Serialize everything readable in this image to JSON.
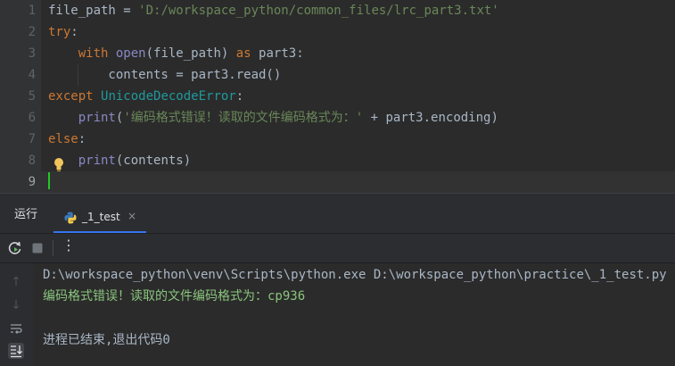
{
  "editor": {
    "line_numbers": [
      "1",
      "2",
      "3",
      "4",
      "5",
      "6",
      "7",
      "8",
      "9"
    ],
    "lines": [
      {
        "parts": [
          {
            "t": "file_path",
            "c": "var"
          },
          {
            "t": " = ",
            "c": "var"
          },
          {
            "t": "'D:/workspace_python/common_files/lrc_part3.txt'",
            "c": "str"
          }
        ]
      },
      {
        "parts": [
          {
            "t": "try",
            "c": "kw"
          },
          {
            "t": ":",
            "c": "var"
          }
        ]
      },
      {
        "parts": [
          {
            "t": "    ",
            "c": "var"
          },
          {
            "t": "with ",
            "c": "kw"
          },
          {
            "t": "open",
            "c": "fn"
          },
          {
            "t": "(file_path) ",
            "c": "var"
          },
          {
            "t": "as ",
            "c": "kw"
          },
          {
            "t": "part3:",
            "c": "var"
          }
        ]
      },
      {
        "parts": [
          {
            "t": "        contents = part3.read()",
            "c": "var"
          }
        ]
      },
      {
        "parts": [
          {
            "t": "except ",
            "c": "kw"
          },
          {
            "t": "UnicodeDecodeError",
            "c": "cls"
          },
          {
            "t": ":",
            "c": "var"
          }
        ]
      },
      {
        "parts": [
          {
            "t": "    ",
            "c": "var"
          },
          {
            "t": "print",
            "c": "fn"
          },
          {
            "t": "(",
            "c": "var"
          },
          {
            "t": "'编码格式错误！读取的文件编码格式为：'",
            "c": "str"
          },
          {
            "t": " + part3.encoding)",
            "c": "var"
          }
        ]
      },
      {
        "parts": [
          {
            "t": "else",
            "c": "kw"
          },
          {
            "t": ":",
            "c": "var"
          }
        ]
      },
      {
        "parts": [
          {
            "t": "    ",
            "c": "var"
          },
          {
            "t": "print",
            "c": "fn"
          },
          {
            "t": "(contents)",
            "c": "var"
          }
        ]
      },
      {
        "parts": [
          {
            "t": "",
            "c": "var"
          }
        ]
      }
    ],
    "current_line_index": 8
  },
  "run_panel": {
    "title": "运行",
    "tab_label": "_1_test",
    "tab_close": "×",
    "more_menu": "⋮"
  },
  "console": {
    "command": "D:\\workspace_python\\venv\\Scripts\\python.exe D:\\workspace_python\\practice\\_1_test.py",
    "stdout": "编码格式错误！读取的文件编码格式为：cp936",
    "exit_message": "进程已结束,退出代码0"
  },
  "colors": {
    "accent": "#3574f0",
    "caret": "#25c825",
    "stdout": "#89c47d"
  }
}
